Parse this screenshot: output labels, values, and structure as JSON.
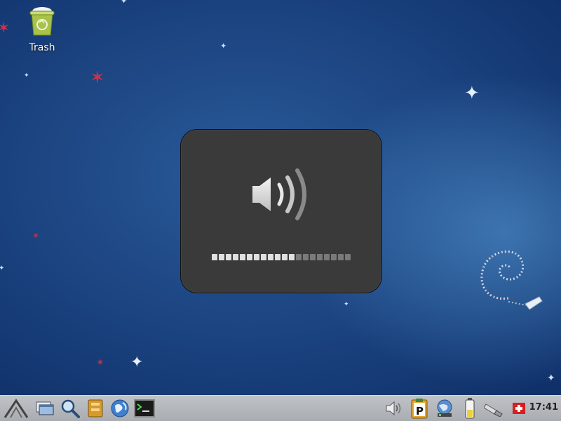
{
  "desktop": {
    "icons": [
      {
        "label": "Trash",
        "icon": "trash-icon"
      }
    ]
  },
  "osd": {
    "icon": "volume-high-icon",
    "volume_level": 0.6,
    "segments_total": 20,
    "segments_filled": 12
  },
  "taskbar": {
    "launchers": [
      {
        "name": "application-menu-icon"
      },
      {
        "name": "show-desktop-icon"
      },
      {
        "name": "search-icon"
      },
      {
        "name": "file-manager-icon"
      },
      {
        "name": "web-browser-icon"
      },
      {
        "name": "terminal-icon"
      }
    ],
    "tray": [
      {
        "name": "volume-icon"
      },
      {
        "name": "clipboard-icon"
      },
      {
        "name": "network-icon"
      },
      {
        "name": "battery-icon"
      },
      {
        "name": "usb-icon"
      },
      {
        "name": "keyboard-layout-flag-icon"
      }
    ],
    "clock": "17:41"
  },
  "colors": {
    "desktop_bg": "#173d78",
    "osd_bg": "#3a3a3a",
    "taskbar_bg": "#b5b9bd"
  }
}
